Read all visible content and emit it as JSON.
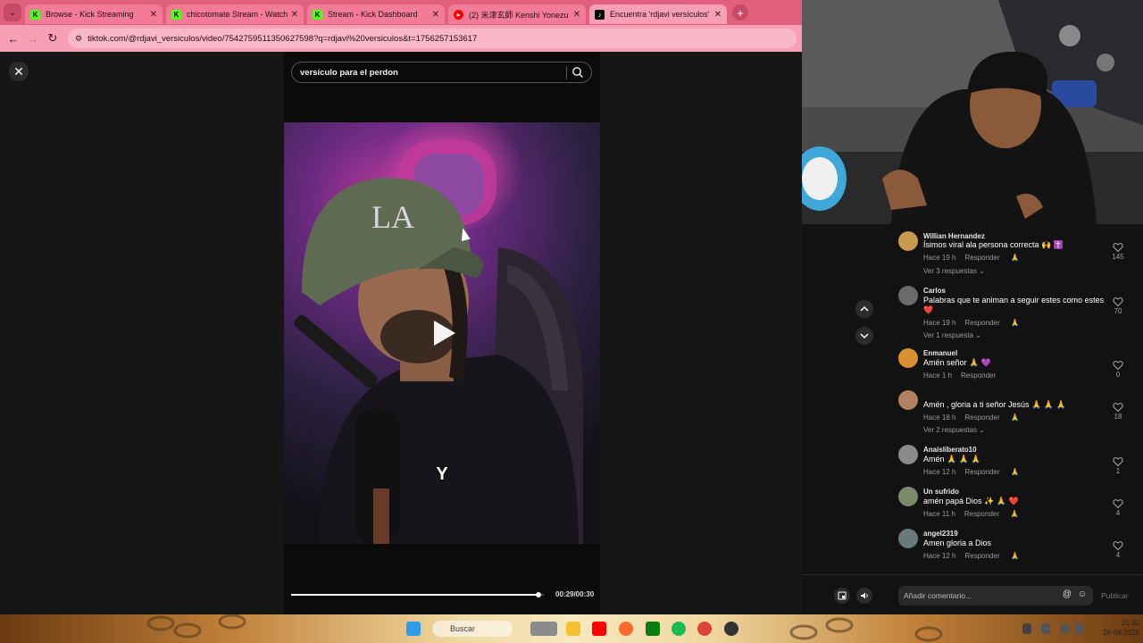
{
  "browser": {
    "tabs": [
      {
        "label": "Browse - Kick Streaming",
        "favicon": "kick-icon"
      },
      {
        "label": "chicotomate Stream - Watch Li",
        "favicon": "kick-icon"
      },
      {
        "label": "Stream - Kick Dashboard",
        "favicon": "kick-icon"
      },
      {
        "label": "(2) 米津玄師 Kenshi Yonezu - Li",
        "favicon": "youtube-icon"
      },
      {
        "label": "Encuentra 'rdjavi versículos' en",
        "favicon": "tiktok-icon",
        "active": true
      }
    ],
    "url": "tiktok.com/@rdjavi_versiculos/video/7542759511350627598?q=rdjavi%20versiculos&t=1756257153617"
  },
  "video": {
    "search_query": "versículo para el perdon",
    "caption": "Y",
    "time": "00:29/00:30",
    "progress": 0.98
  },
  "comments": [
    {
      "name": "Willian Hernandez",
      "text": "Ísimos viral ala persona correcta 🙌 ✝️",
      "time": "Hace 19 h",
      "reply": "Responder",
      "likes": "145",
      "replies": "Ver 3 respuestas ⌄"
    },
    {
      "name": "Carlos",
      "text": "Palabras que te animan a seguir estes como estes ❤️",
      "time": "Hace 19 h",
      "reply": "Responder",
      "likes": "70",
      "replies": "Ver 1 respuesta ⌄"
    },
    {
      "name": "Enmanuel",
      "text": "Amén señor 🙏 💜",
      "time": "Hace 1 h",
      "reply": "Responder",
      "likes": "0",
      "replies": ""
    },
    {
      "name": "",
      "text": "Amén , gloria a ti señor Jesús 🙏 🙏 🙏",
      "time": "Hace 18 h",
      "reply": "Responder",
      "likes": "18",
      "replies": "Ver 2 respuestas ⌄"
    },
    {
      "name": "Anaisliberato10",
      "text": "Amén 🙏 🙏 🙏",
      "time": "Hace 12 h",
      "reply": "Responder",
      "likes": "1",
      "replies": ""
    },
    {
      "name": "Un sufrido",
      "text": "amén papá Dios ✨ 🙏 ❤️",
      "time": "Hace 11 h",
      "reply": "Responder",
      "likes": "4",
      "replies": ""
    },
    {
      "name": "angel2319",
      "text": "Amen gloria a Dios",
      "time": "Hace 12 h",
      "reply": "Responder",
      "likes": "4",
      "replies": ""
    }
  ],
  "comment_box": {
    "placeholder": "Añadir comentario...",
    "publish": "Publicar"
  },
  "taskbar": {
    "search": "Buscar",
    "time": "21:31",
    "date": "26-08-2025"
  },
  "colors": {
    "browser_accent": "#f7a0b5",
    "tiktok_bg": "#121212",
    "kick_green": "#53fc18"
  }
}
